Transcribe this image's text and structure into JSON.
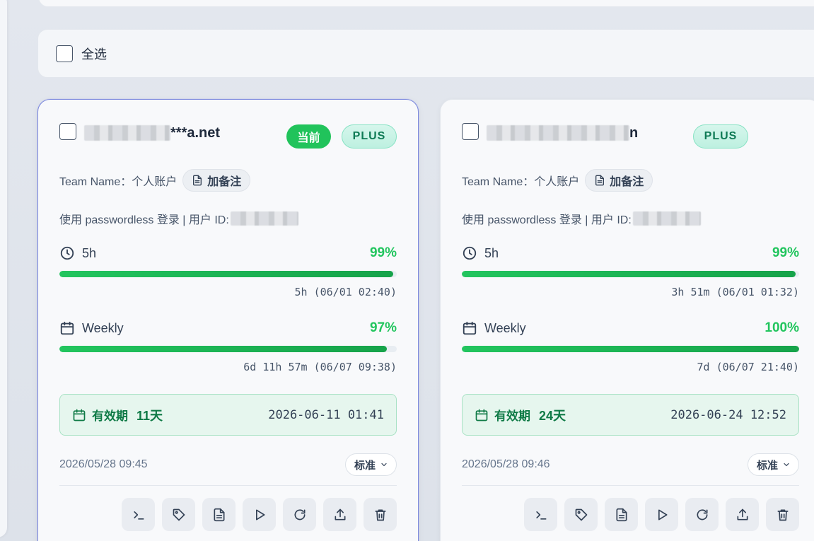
{
  "select_all": {
    "label": "全选"
  },
  "accounts": [
    {
      "email_suffix": "***a.net",
      "current_badge": "当前",
      "plan": "PLUS",
      "team_name": "Team Name：个人账户",
      "note_button": "加备注",
      "login_info": "使用 passwordless 登录 | 用户 ID:",
      "usage_5h": {
        "label": "5h",
        "percent": "99%",
        "fill": 0.99,
        "reset": "5h (06/01 02:40)"
      },
      "usage_weekly": {
        "label": "Weekly",
        "percent": "97%",
        "fill": 0.97,
        "reset": "6d 11h 57m (06/07 09:38)"
      },
      "validity": {
        "label": "有效期",
        "days": "11天",
        "expires": "2026-06-11 01:41"
      },
      "created": "2026/05/28 09:45",
      "mode": "标准"
    },
    {
      "email_suffix": "n",
      "plan": "PLUS",
      "team_name": "Team Name：个人账户",
      "note_button": "加备注",
      "login_info": "使用 passwordless 登录 | 用户 ID:",
      "usage_5h": {
        "label": "5h",
        "percent": "99%",
        "fill": 0.99,
        "reset": "3h 51m (06/01 01:32)"
      },
      "usage_weekly": {
        "label": "Weekly",
        "percent": "100%",
        "fill": 1.0,
        "reset": "7d (06/07 21:40)"
      },
      "validity": {
        "label": "有效期",
        "days": "24天",
        "expires": "2026-06-24 12:52"
      },
      "created": "2026/05/28 09:46",
      "mode": "标准"
    }
  ],
  "action_icons": [
    "terminal-icon",
    "tag-icon",
    "document-icon",
    "play-icon",
    "refresh-icon",
    "upload-icon",
    "trash-icon"
  ],
  "colors": {
    "accent_green": "#22c55e",
    "current_border": "#7b88dd",
    "validity_bg": "#e6f6ee"
  }
}
